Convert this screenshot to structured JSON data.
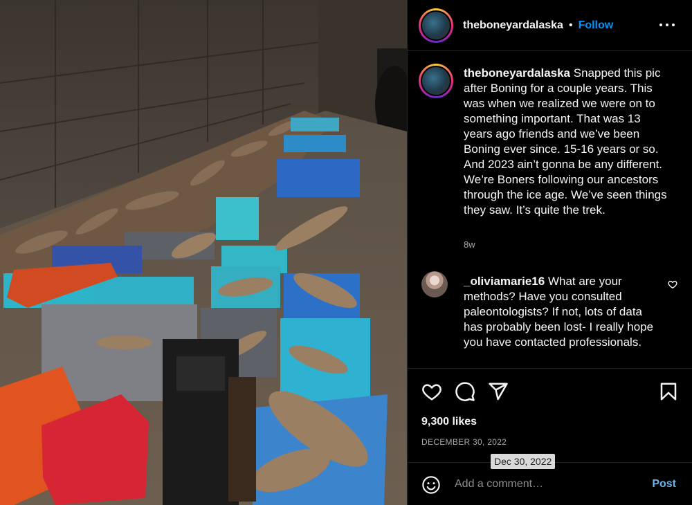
{
  "post": {
    "username": "theboneyardalaska",
    "follow_label": "Follow",
    "separator": "•",
    "caption_text": "Snapped this pic after Boning for a couple years. This was when we realized we were on to something important. That was 13 years ago friends and we’ve been Boning ever since. 15-16 years or so. And 2023 ain’t gonna be any different. We’re Boners following our ancestors through the ice age. We’ve seen things they saw. It’s quite the trek.",
    "caption_age": "8w"
  },
  "comment": {
    "username": "_oliviamarie16",
    "text": "What are your methods? Have you consulted paleontologists? If not, lots of data has probably been lost- I really hope you have contacted professionals."
  },
  "stats": {
    "likes": "9,300 likes",
    "date": "DECEMBER 30, 2022",
    "tooltip": "Dec 30, 2022"
  },
  "composer": {
    "placeholder": "Add a comment…",
    "post_label": "Post"
  },
  "icons": [
    "more-icon",
    "heart-icon",
    "comment-icon",
    "share-icon",
    "bookmark-icon",
    "emoji-icon",
    "like-comment-icon"
  ],
  "colors": {
    "follow": "#0095f6",
    "post": "#6bb4e8",
    "muted": "#a8a8a8",
    "background": "#000000"
  }
}
